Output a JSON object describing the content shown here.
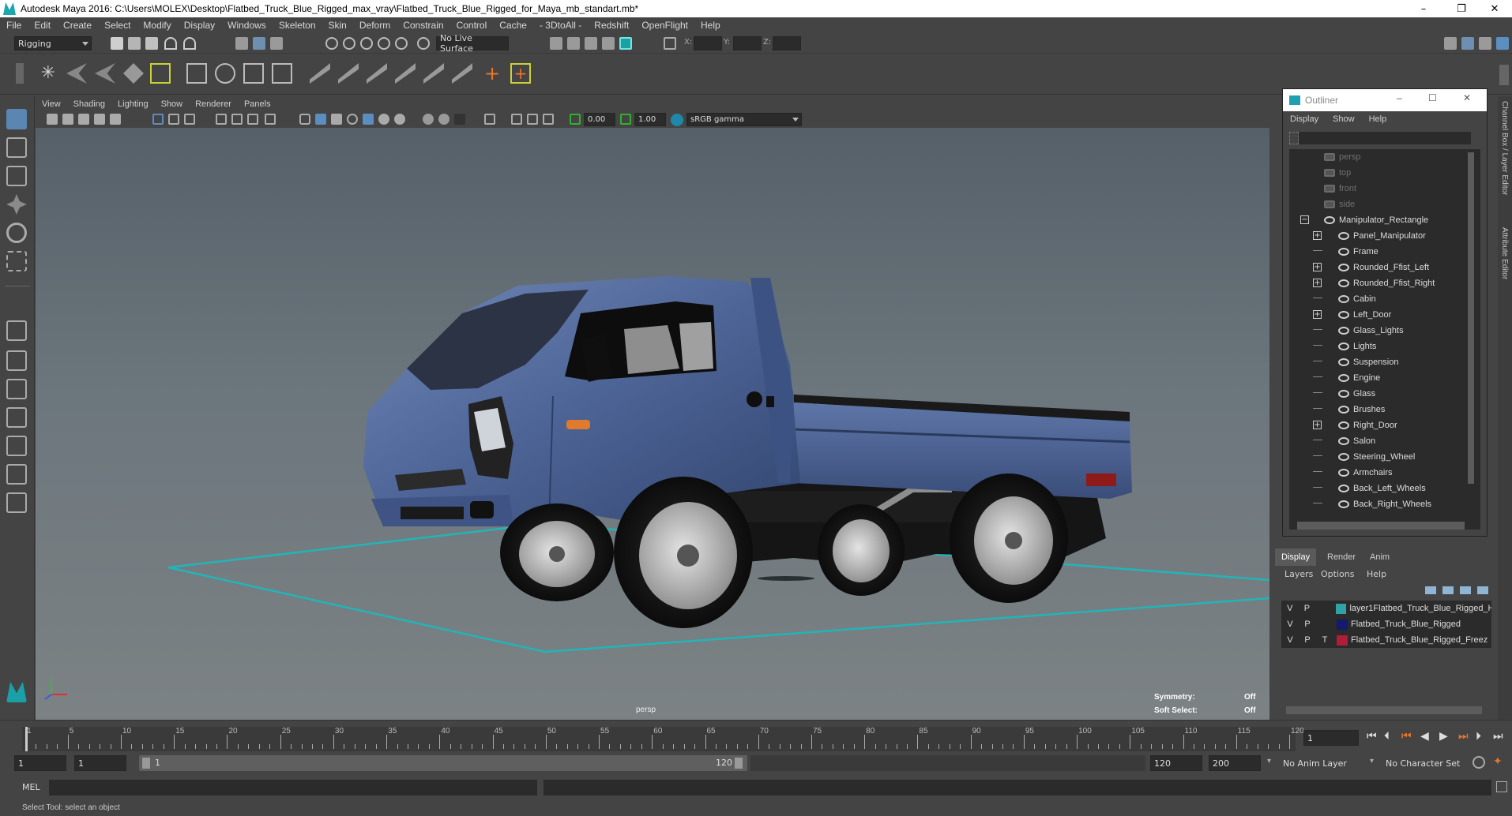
{
  "window": {
    "title": "Autodesk Maya 2016: C:\\Users\\MOLEX\\Desktop\\Flatbed_Truck_Blue_Rigged_max_vray\\Flatbed_Truck_Blue_Rigged_for_Maya_mb_standart.mb*",
    "minimize": "–",
    "restore": "❐",
    "close": "✕"
  },
  "menubar": [
    "File",
    "Edit",
    "Create",
    "Select",
    "Modify",
    "Display",
    "Windows",
    "Skeleton",
    "Skin",
    "Deform",
    "Constrain",
    "Control",
    "Cache",
    "- 3DtoAll -",
    "Redshift",
    "OpenFlight",
    "Help"
  ],
  "statusline": {
    "menuset": "Rigging",
    "live_surface": "No Live Surface",
    "x_label": "X:",
    "y_label": "Y:",
    "z_label": "Z:"
  },
  "viewport": {
    "menu": [
      "View",
      "Shading",
      "Lighting",
      "Show",
      "Renderer",
      "Panels"
    ],
    "near_value": "0.00",
    "far_value": "1.00",
    "color_space": "sRGB gamma",
    "camera_label": "persp",
    "symmetry_label": "Symmetry:",
    "symmetry_value": "Off",
    "soft_select_label": "Soft Select:",
    "soft_select_value": "Off"
  },
  "outliner": {
    "title": "Outliner",
    "menu": [
      "Display",
      "Show",
      "Help"
    ],
    "items": [
      {
        "label": "persp",
        "camera": true,
        "expander": false
      },
      {
        "label": "top",
        "camera": true,
        "expander": false
      },
      {
        "label": "front",
        "camera": true,
        "expander": false
      },
      {
        "label": "side",
        "camera": true,
        "expander": false
      },
      {
        "label": "Manipulator_Rectangle",
        "camera": false,
        "expander": true,
        "expander_symbol": "−",
        "root": true
      },
      {
        "label": "Panel_Manipulator",
        "camera": false,
        "expander": true,
        "expander_symbol": "+"
      },
      {
        "label": "Frame",
        "camera": false,
        "expander": false
      },
      {
        "label": "Rounded_Ffist_Left",
        "camera": false,
        "expander": true,
        "expander_symbol": "+"
      },
      {
        "label": "Rounded_Ffist_Right",
        "camera": false,
        "expander": true,
        "expander_symbol": "+"
      },
      {
        "label": "Cabin",
        "camera": false,
        "expander": false
      },
      {
        "label": "Left_Door",
        "camera": false,
        "expander": true,
        "expander_symbol": "+"
      },
      {
        "label": "Glass_Lights",
        "camera": false,
        "expander": false
      },
      {
        "label": "Lights",
        "camera": false,
        "expander": false
      },
      {
        "label": "Suspension",
        "camera": false,
        "expander": false
      },
      {
        "label": "Engine",
        "camera": false,
        "expander": false
      },
      {
        "label": "Glass",
        "camera": false,
        "expander": false
      },
      {
        "label": "Brushes",
        "camera": false,
        "expander": false
      },
      {
        "label": "Right_Door",
        "camera": false,
        "expander": true,
        "expander_symbol": "+"
      },
      {
        "label": "Salon",
        "camera": false,
        "expander": false
      },
      {
        "label": "Steering_Wheel",
        "camera": false,
        "expander": false
      },
      {
        "label": "Armchairs",
        "camera": false,
        "expander": false
      },
      {
        "label": "Back_Left_Wheels",
        "camera": false,
        "expander": false
      },
      {
        "label": "Back_Right_Wheels",
        "camera": false,
        "expander": false
      }
    ]
  },
  "side_tabs": {
    "channel_box": "Channel Box / Layer Editor",
    "attribute_editor": "Attribute Editor"
  },
  "layer_editor": {
    "tabs": [
      "Display",
      "Render",
      "Anim"
    ],
    "menu": [
      "Layers",
      "Options",
      "Help"
    ],
    "layers": [
      {
        "v": "V",
        "p": "P",
        "t": "",
        "color": "#2fa3a8",
        "name": "layer1Flatbed_Truck_Blue_Rigged_H"
      },
      {
        "v": "V",
        "p": "P",
        "t": "",
        "color": "#141a6e",
        "name": "Flatbed_Truck_Blue_Rigged"
      },
      {
        "v": "V",
        "p": "P",
        "t": "T",
        "color": "#b01c3a",
        "name": "Flatbed_Truck_Blue_Rigged_Freez"
      }
    ]
  },
  "timeline": {
    "ticks": [
      "1",
      "5",
      "10",
      "15",
      "20",
      "25",
      "30",
      "35",
      "40",
      "45",
      "50",
      "55",
      "60",
      "65",
      "70",
      "75",
      "80",
      "85",
      "90",
      "95",
      "100",
      "105",
      "110",
      "115",
      "120"
    ],
    "current_frame": "1"
  },
  "range": {
    "start": "1",
    "playback_start": "1",
    "slider_start": "1",
    "slider_end": "120",
    "playback_end": "120",
    "end": "200",
    "anim_layer": "No Anim Layer",
    "character_set": "No Character Set"
  },
  "commandline": {
    "label": "MEL"
  },
  "helpline": {
    "text": "Select Tool: select an object"
  }
}
